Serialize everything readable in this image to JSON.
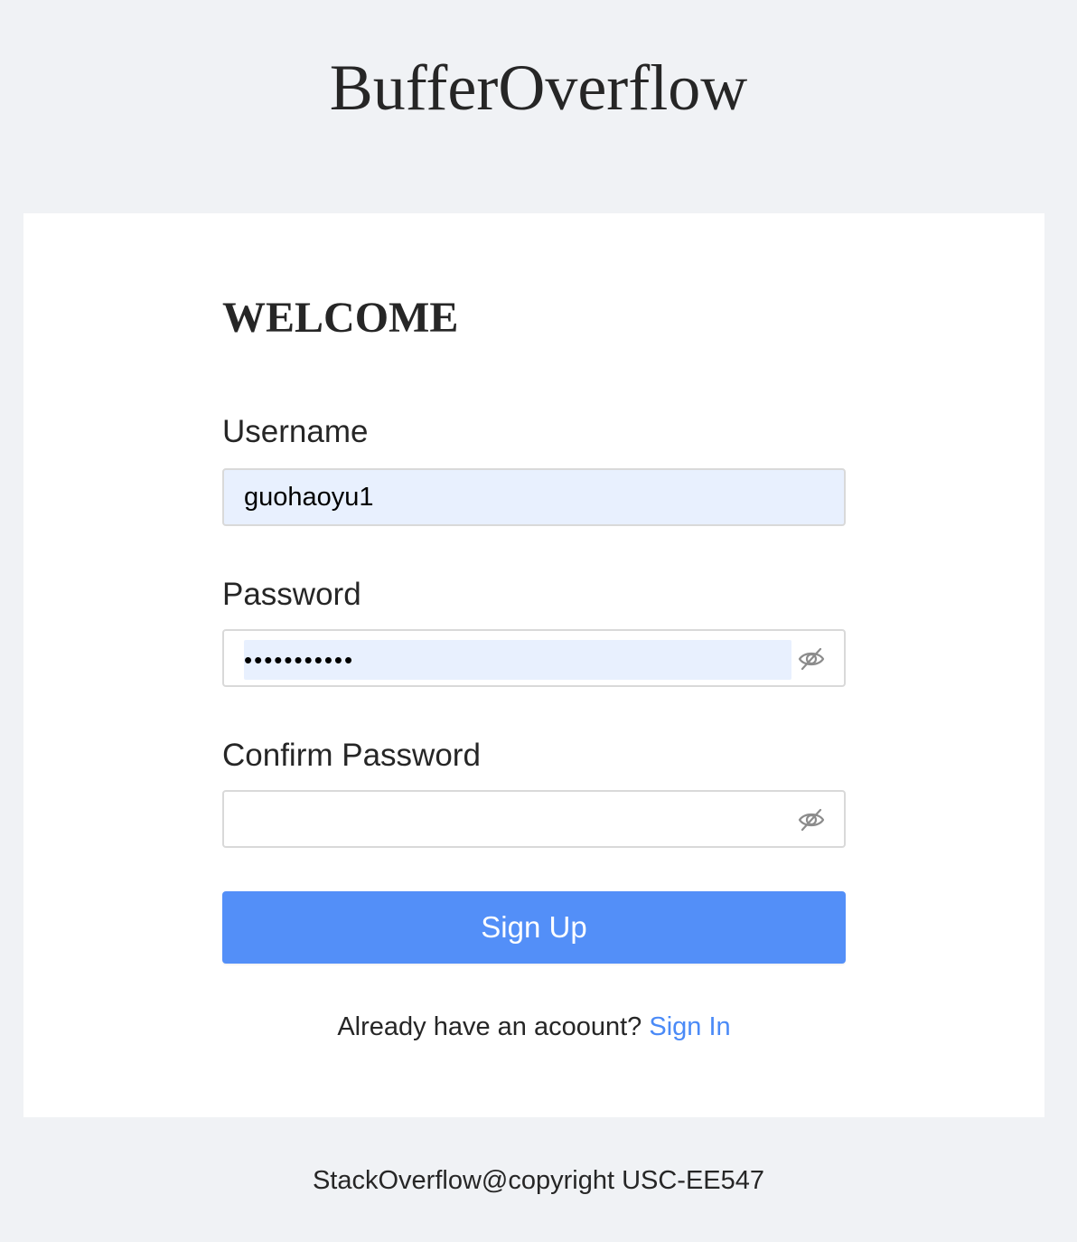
{
  "header": {
    "site_title": "BufferOverflow"
  },
  "form": {
    "heading": "WELCOME",
    "username": {
      "label": "Username",
      "value": "guohaoyu1"
    },
    "password": {
      "label": "Password",
      "value": "•••••••••••",
      "visibility_icon": "eye-off-icon"
    },
    "confirm_password": {
      "label": "Confirm Password",
      "value": "",
      "visibility_icon": "eye-off-icon"
    },
    "submit_label": "Sign Up",
    "signin_prompt": "Already have an acoount?",
    "signin_link": "Sign In"
  },
  "footer": {
    "text": "StackOverflow@copyright USC-EE547"
  },
  "colors": {
    "page_background": "#f0f2f5",
    "card_background": "#ffffff",
    "primary": "#538ff8",
    "link": "#4a8af7",
    "autofill": "#e8f0fe"
  }
}
